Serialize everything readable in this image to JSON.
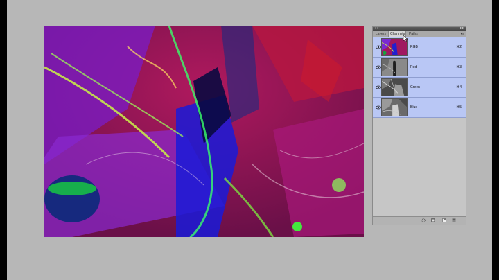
{
  "panel": {
    "tabs": [
      {
        "label": "Layers"
      },
      {
        "label": "Channels",
        "active": true
      },
      {
        "label": "Paths"
      }
    ],
    "channels": [
      {
        "name": "RGB",
        "shortcut": "⌘2"
      },
      {
        "name": "Red",
        "shortcut": "⌘3"
      },
      {
        "name": "Green",
        "shortcut": "⌘4"
      },
      {
        "name": "Blue",
        "shortcut": "⌘5"
      }
    ],
    "footer_icons": [
      "load-selection-icon",
      "save-selection-icon",
      "new-channel-icon",
      "delete-channel-icon"
    ]
  },
  "colors": {
    "selected_row": "#b9c7f5",
    "workspace": "#b7b7b7"
  }
}
